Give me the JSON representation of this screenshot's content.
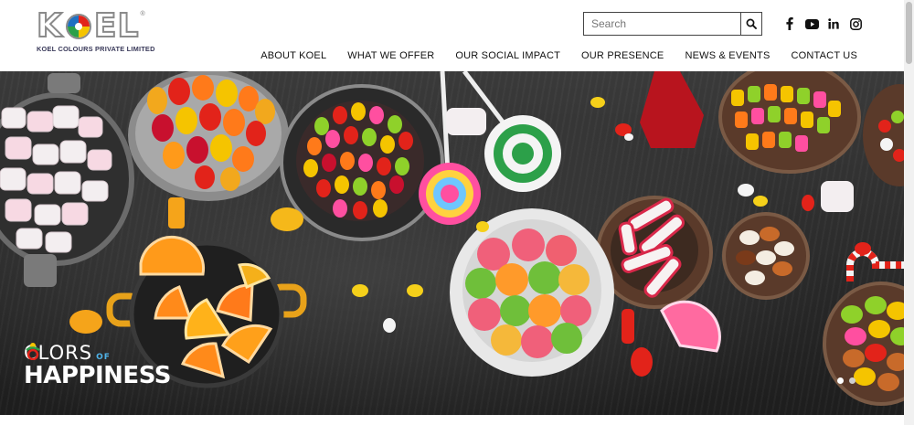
{
  "brand": {
    "name_left": "K",
    "name_right": "EL",
    "trademark": "®",
    "subtitle": "KOEL COLOURS PRIVATE LIMITED"
  },
  "search": {
    "placeholder": "Search",
    "button_icon": "search-icon"
  },
  "social": [
    "facebook-icon",
    "youtube-icon",
    "linkedin-icon",
    "instagram-icon"
  ],
  "nav": {
    "items": [
      {
        "label": "ABOUT KOEL"
      },
      {
        "label": "WHAT WE OFFER"
      },
      {
        "label": "OUR SOCIAL IMPACT"
      },
      {
        "label": "OUR PRESENCE"
      },
      {
        "label": "NEWS & EVENTS"
      },
      {
        "label": "CONTACT US"
      }
    ]
  },
  "hero": {
    "tagline_line1_c": "C",
    "tagline_line1_rest": "LORS",
    "tagline_of": "OF",
    "tagline_line2": "HAPPINESS",
    "slides_total": 2,
    "active_slide": 1
  },
  "colors": {
    "accent_blue": "#4fb3e8",
    "logo_red": "#e2231a",
    "logo_green": "#2ca049",
    "logo_yellow": "#f5c400",
    "logo_blue": "#1f6fc1"
  }
}
